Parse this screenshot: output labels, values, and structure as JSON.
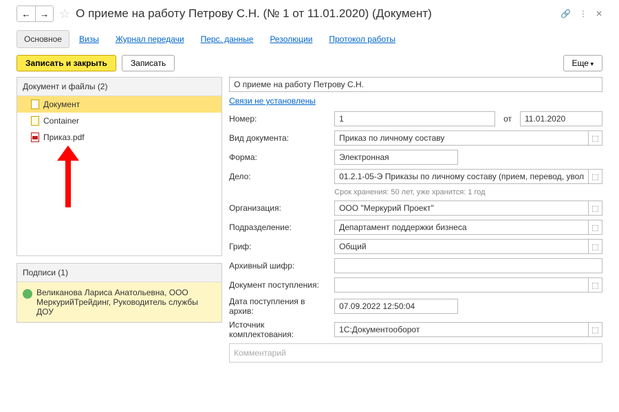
{
  "header": {
    "title": "О приеме на работу Петрову С.Н. (№ 1 от 11.01.2020) (Документ)"
  },
  "tabs": {
    "main": "Основное",
    "visas": "Визы",
    "journal": "Журнал передачи",
    "pers": "Перс. данные",
    "resol": "Резолюции",
    "protocol": "Протокол работы"
  },
  "toolbar": {
    "save_close": "Записать и закрыть",
    "save": "Записать",
    "more": "Еще"
  },
  "files_panel": {
    "title": "Документ и файлы (2)",
    "items": [
      {
        "label": "Документ"
      },
      {
        "label": "Container"
      },
      {
        "label": "Приказ.pdf"
      }
    ]
  },
  "sign_panel": {
    "title": "Подписи (1)",
    "text": "Великанова Лариса Анатольевна, ООО МеркурийТрейдинг, Руководитель службы ДОУ"
  },
  "form": {
    "title_value": "О приеме на работу Петрову С.Н.",
    "link_text": "Связи не установлены",
    "lbl_number": "Номер:",
    "number": "1",
    "from": "от",
    "date": "11.01.2020",
    "lbl_kind": "Вид документа:",
    "kind": "Приказ по личному составу",
    "lbl_form": "Форма:",
    "form_val": "Электронная",
    "lbl_case": "Дело:",
    "case_val": "01.2.1-05-Э Приказы по личному составу (прием, перевод, увол",
    "hint": "Срок хранения: 50 лет, уже хранится: 1 год",
    "lbl_org": "Организация:",
    "org": "ООО \"Меркурий Проект\"",
    "lbl_dept": "Подразделение:",
    "dept": "Департамент поддержки бизнеса",
    "lbl_grif": "Гриф:",
    "grif": "Общий",
    "lbl_arch": "Архивный шифр:",
    "arch": "",
    "lbl_docin": "Документ поступления:",
    "docin": "",
    "lbl_datein": "Дата поступления в архив:",
    "datein": "07.09.2022 12:50:04",
    "lbl_source": "Источник комплектования:",
    "source": "1С:Документооборот",
    "comment_ph": "Комментарий"
  }
}
